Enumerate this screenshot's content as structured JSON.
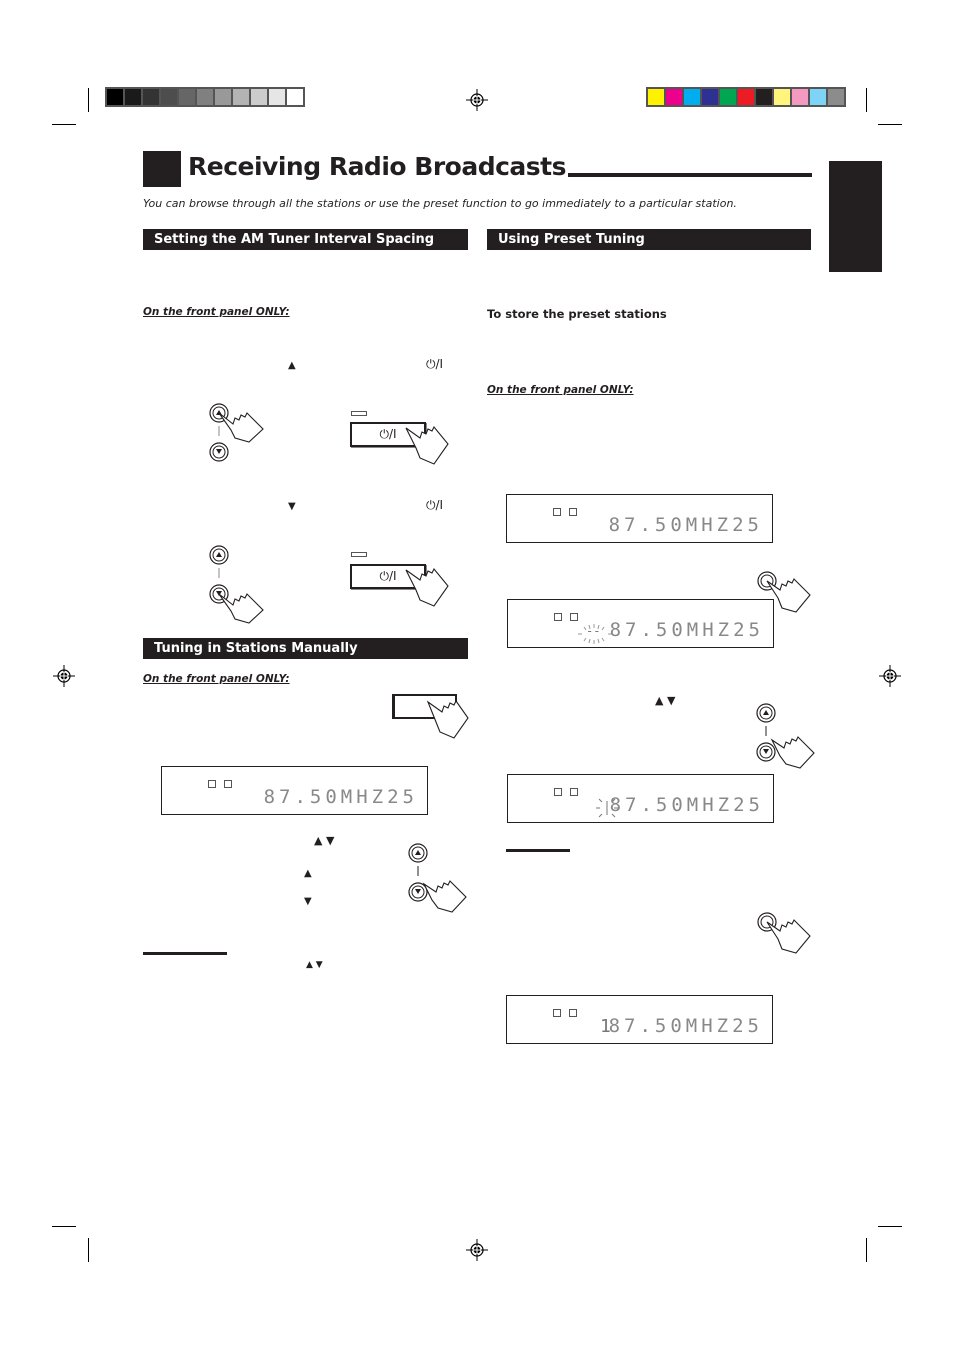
{
  "print_marks": {
    "grayscale_swatches": [
      "#000000",
      "#1a1a1a",
      "#333333",
      "#4d4d4d",
      "#666666",
      "#808080",
      "#999999",
      "#b3b3b3",
      "#cccccc",
      "#e6e6e6",
      "#ffffff"
    ],
    "color_swatches": [
      "#fff200",
      "#ec008c",
      "#00aeef",
      "#2e3192",
      "#00a651",
      "#ed1c24",
      "#231f20",
      "#fff57a",
      "#f49ac1",
      "#7dd4f7",
      "#8c8c8c"
    ]
  },
  "page": {
    "title": "Receiving Radio Broadcasts",
    "intro": "You can browse through all the stations or use the preset function to go immediately to a particular station."
  },
  "left_column": {
    "section1": {
      "heading": "Setting the AM Tuner Interval Spacing",
      "panel_note": "On the front panel ONLY:",
      "step1_arrow": "▲",
      "step1_power": "⏻/I",
      "step2_arrow": "▼",
      "step2_power": "⏻/I",
      "power_button_label": "⏻/I"
    },
    "section2": {
      "heading": "Tuning in Stations Manually",
      "panel_note": "On the front panel ONLY:",
      "display": {
        "frequency": "87.50MHZ25"
      },
      "arrows_pair": "▲ ▼",
      "arrow_up": "▲",
      "arrow_down": "▼",
      "note_arrows": "▲ ▼"
    }
  },
  "right_column": {
    "section": {
      "heading": "Using Preset Tuning",
      "subheading": "To store the preset stations",
      "panel_note": "On the front panel ONLY:",
      "display1": {
        "frequency": "87.50MHZ25"
      },
      "display2": {
        "frequency": "87.50MHZ25",
        "preset": "--"
      },
      "arrows_pair": "▲ ▼",
      "display3": {
        "frequency": "87.50MHZ25",
        "preset": "1"
      },
      "display4": {
        "frequency": "87.50MHZ25",
        "preset": "1"
      }
    }
  }
}
